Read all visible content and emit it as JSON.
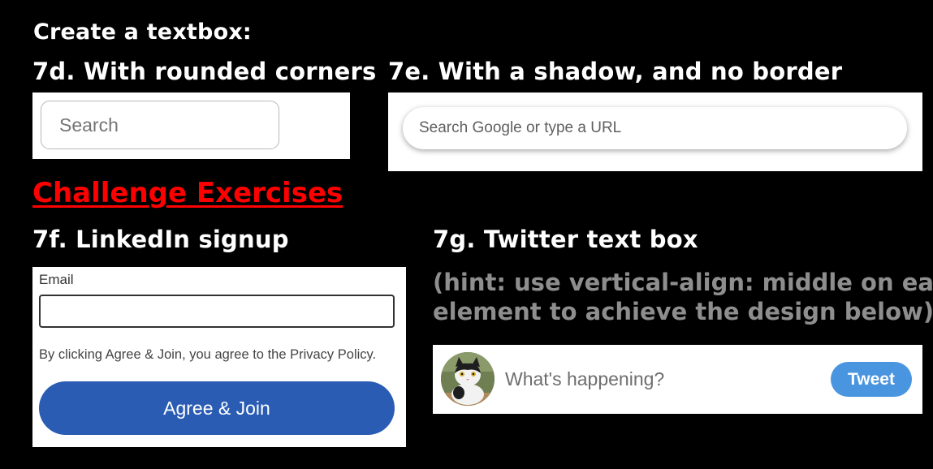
{
  "title": "Create a textbox:",
  "ex7d": {
    "heading": "7d. With rounded corners",
    "placeholder": "Search"
  },
  "ex7e": {
    "heading": "7e. With a shadow, and no border",
    "placeholder": "Search Google or type a URL"
  },
  "challenge": "Challenge Exercises",
  "ex7f": {
    "heading": "7f. LinkedIn signup",
    "email_label": "Email",
    "email_value": "",
    "policy_text": "By clicking Agree & Join, you agree to the Privacy Policy.",
    "button_label": "Agree & Join",
    "button_color": "#2a5cb4"
  },
  "ex7g": {
    "heading": "7g. Twitter text box",
    "hint_line1": "(hint: use vertical-align: middle on each",
    "hint_line2": "element to achieve the design below)",
    "placeholder": "What's happening?",
    "button_label": "Tweet",
    "button_color": "#4a95e0",
    "avatar_icon": "cat-avatar-icon"
  }
}
